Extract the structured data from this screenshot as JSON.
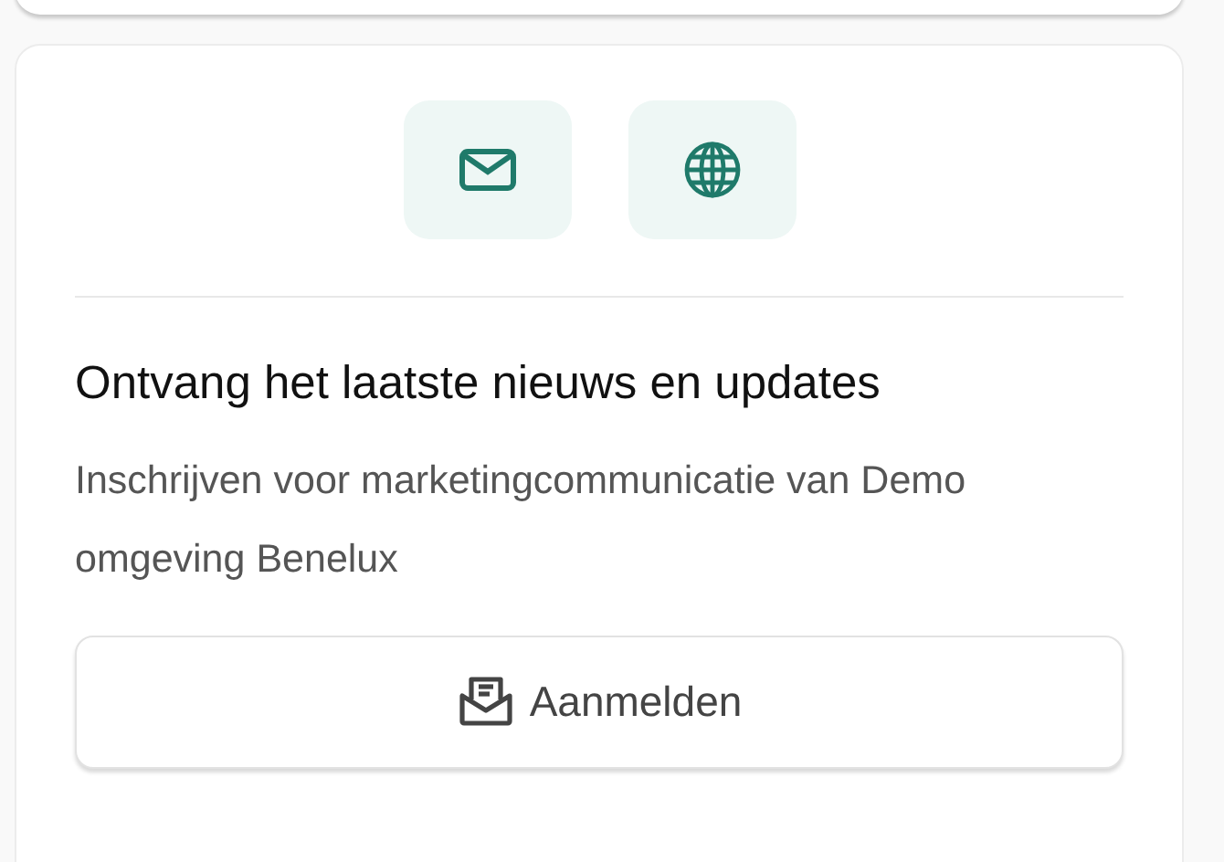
{
  "contact_buttons": [
    {
      "kind": "email"
    },
    {
      "kind": "website"
    }
  ],
  "heading": "Ontvang het laatste nieuws en updates",
  "description": "Inschrijven voor marketingcommunicatie van Demo omgeving Benelux",
  "subscribe_button": {
    "label": "Aanmelden"
  }
}
